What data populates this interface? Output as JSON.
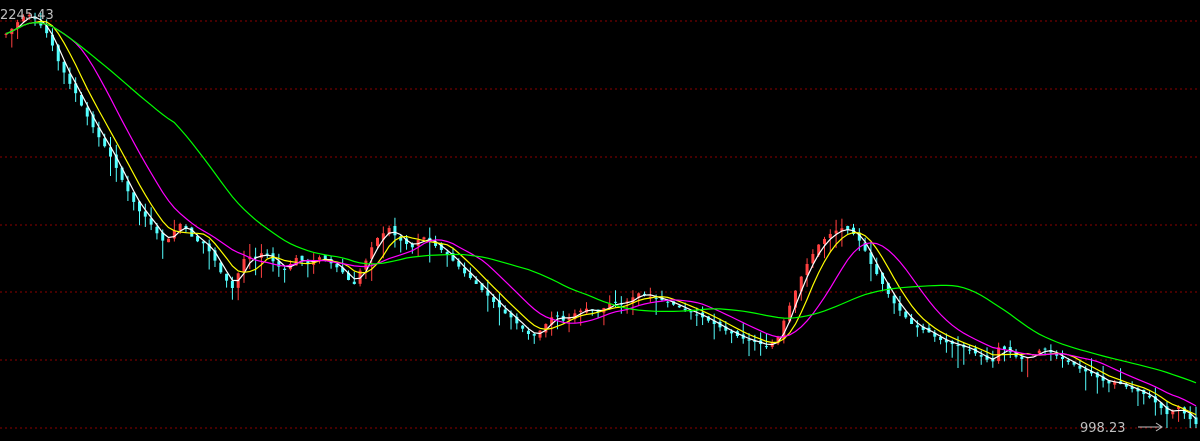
{
  "chart_data": {
    "type": "candlestick",
    "ylim": [
      998.23,
      2245.43
    ],
    "grid": true,
    "max_label": "2245.43",
    "min_label": "998.23",
    "colors": {
      "background": "#000000",
      "grid": "#8b0000",
      "up": "#ff4040",
      "down": "#54ffff",
      "ma_white": "#ffffff",
      "ma_yellow": "#ffff00",
      "ma_magenta": "#ff00ff",
      "ma_green": "#00ff00",
      "label": "#c0c0c0"
    },
    "close": [
      2180,
      2195,
      2215,
      2232,
      2236,
      2224,
      2205,
      2182,
      2145,
      2098,
      2064,
      2030,
      2002,
      1965,
      1932,
      1900,
      1870,
      1843,
      1812,
      1778,
      1742,
      1708,
      1676,
      1648,
      1632,
      1608,
      1582,
      1560,
      1566,
      1590,
      1610,
      1595,
      1572,
      1558,
      1552,
      1528,
      1500,
      1465,
      1440,
      1418,
      1462,
      1505,
      1512,
      1508,
      1522,
      1520,
      1498,
      1482,
      1472,
      1490,
      1508,
      1502,
      1490,
      1498,
      1510,
      1505,
      1492,
      1480,
      1465,
      1442,
      1430,
      1470,
      1500,
      1540,
      1568,
      1582,
      1598,
      1576,
      1560,
      1550,
      1540,
      1562,
      1570,
      1558,
      1544,
      1532,
      1518,
      1500,
      1482,
      1462,
      1448,
      1430,
      1412,
      1395,
      1376,
      1360,
      1342,
      1330,
      1312,
      1296,
      1280,
      1275,
      1290,
      1310,
      1330,
      1335,
      1320,
      1330,
      1342,
      1350,
      1356,
      1350,
      1345,
      1358,
      1370,
      1375,
      1368,
      1378,
      1390,
      1402,
      1398,
      1392,
      1388,
      1382,
      1376,
      1368,
      1360,
      1352,
      1345,
      1338,
      1330,
      1320,
      1310,
      1300,
      1290,
      1282,
      1274,
      1266,
      1260,
      1256,
      1250,
      1242,
      1254,
      1270,
      1320,
      1365,
      1410,
      1452,
      1490,
      1520,
      1548,
      1565,
      1580,
      1590,
      1597,
      1592,
      1580,
      1560,
      1530,
      1490,
      1460,
      1430,
      1400,
      1372,
      1350,
      1330,
      1310,
      1300,
      1292,
      1285,
      1272,
      1262,
      1255,
      1250,
      1245,
      1240,
      1232,
      1222,
      1212,
      1203,
      1198,
      1240,
      1235,
      1225,
      1212,
      1205,
      1210,
      1218,
      1230,
      1235,
      1225,
      1215,
      1205,
      1196,
      1188,
      1176,
      1168,
      1162,
      1150,
      1140,
      1132,
      1138,
      1130,
      1122,
      1115,
      1108,
      1100,
      1090,
      1075,
      1058,
      1040,
      1050,
      1062,
      1042,
      1025,
      1010
    ]
  }
}
